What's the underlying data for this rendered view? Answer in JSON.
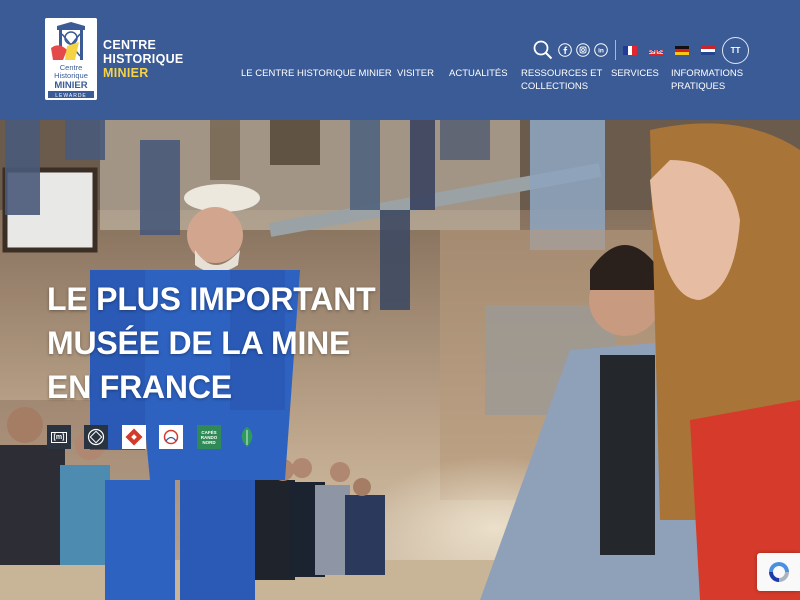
{
  "brand": {
    "line1": "CENTRE",
    "line2": "HISTORIQUE",
    "line3": "MINIER",
    "logo_text_1": "Centre",
    "logo_text_2": "Historique",
    "logo_text_3": "MINIER",
    "logo_text_4": "LEWARDE"
  },
  "utility": {
    "icons": [
      "search-icon",
      "facebook-icon",
      "instagram-icon",
      "linkedin-icon"
    ],
    "languages": [
      "fr",
      "en",
      "de",
      "nl"
    ],
    "text_size_label": "TT"
  },
  "nav": {
    "items": [
      {
        "line1": "LE CENTRE HISTORIQUE MINIER",
        "line2": ""
      },
      {
        "line1": "VISITER",
        "line2": ""
      },
      {
        "line1": "ACTUALITÉS",
        "line2": ""
      },
      {
        "line1": "RESSOURCES ET",
        "line2": "COLLECTIONS"
      },
      {
        "line1": "SERVICES",
        "line2": ""
      },
      {
        "line1": "INFORMATIONS",
        "line2": "PRATIQUES"
      }
    ]
  },
  "hero": {
    "title_line1": "LE PLUS IMPORTANT",
    "title_line2": "MUSÉE DE LA MINE",
    "title_line3": "EN FRANCE"
  },
  "partners": {
    "logo_m": "[m]",
    "logo_cafes": "CAFÉS RANDO NORD"
  },
  "colors": {
    "header_bg": "#3a5b96",
    "brand_accent": "#f6d245",
    "text": "#ffffff"
  }
}
